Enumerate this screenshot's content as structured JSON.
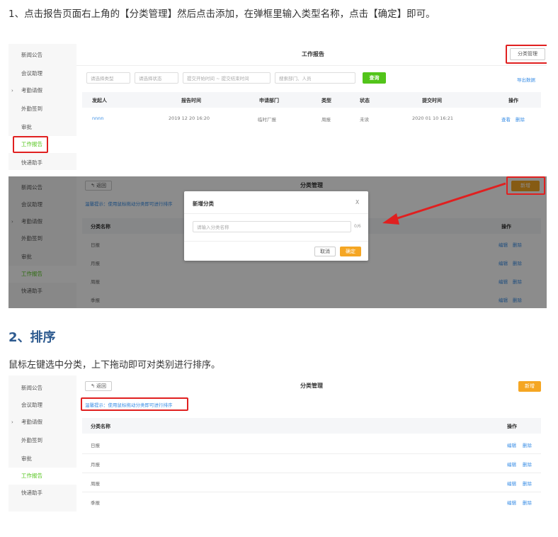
{
  "article": {
    "step1": "1、点击报告页面右上角的【分类管理】然后点击添加，在弹框里输入类型名称，点击【确定】即可。",
    "section2_title": "2、排序",
    "step2": "鼠标左键选中分类，上下拖动即可对类别进行排序。"
  },
  "sidebar": {
    "items": [
      "新闻公告",
      "会议助理",
      "考勤请假",
      "外勤签到",
      "审批",
      "工作报告",
      "快递助手"
    ]
  },
  "shot1": {
    "title": "工作报告",
    "category_btn": "分类管理",
    "filters": [
      "请选择类型",
      "请选择状态",
      "提交开始时间 ~ 提交结束时间",
      "搜索部门、人员"
    ],
    "search_btn": "查询",
    "export": "导出数据",
    "columns": [
      "发起人",
      "报告时间",
      "申请部门",
      "类型",
      "状态",
      "提交时间",
      "操作"
    ],
    "row": [
      "nnnn",
      "2019 12 20 16:20",
      "临时厂报",
      "周报",
      "未读",
      "2020 01 10 16:21"
    ],
    "actions": [
      "查看",
      "删除"
    ]
  },
  "shot2": {
    "back": "返回",
    "title": "分类管理",
    "new_btn": "新增",
    "tip": "温馨提示：使用鼠标拖动分类即可进行排序",
    "col_name": "分类名称",
    "col_op": "操作",
    "rows": [
      "日报",
      "月报",
      "周报",
      "季报"
    ],
    "edit": "编辑",
    "del": "删除",
    "dialog_title": "新增分类",
    "close": "X",
    "input_placeholder": "请输入分类名称",
    "counter": "0/6",
    "cancel": "取消",
    "ok": "确定"
  },
  "shot3": {
    "back": "返回",
    "title": "分类管理",
    "new_btn": "新增",
    "tip": "温馨提示：使用鼠标拖动分类即可进行排序",
    "col_name": "分类名称",
    "col_op": "操作",
    "rows": [
      "日报",
      "月报",
      "周报",
      "季报"
    ],
    "edit": "编辑",
    "del": "删除"
  }
}
